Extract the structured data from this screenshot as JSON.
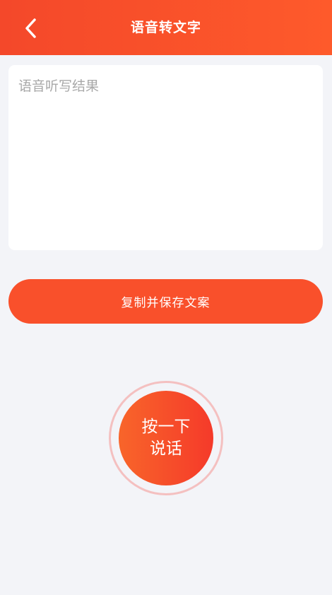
{
  "header": {
    "title": "语音转文字",
    "back_icon": "chevron-left-icon",
    "background": "#fe5a2b"
  },
  "result": {
    "value": "",
    "placeholder": "语音听写结果"
  },
  "copy_button": {
    "label": "复制并保存文案",
    "color": "#f9502b"
  },
  "record_button": {
    "line1": "按一下",
    "line2": "说话",
    "ring_color": "#f4c0c0"
  }
}
